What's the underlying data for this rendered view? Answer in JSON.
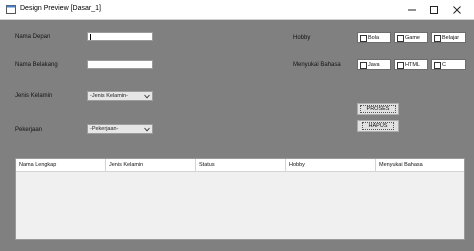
{
  "window": {
    "title": "Design Preview [Dasar_1]",
    "controls": [
      "minimize-icon",
      "maximize-icon",
      "close-icon"
    ]
  },
  "form": {
    "nama_depan_label": "Nama Depan",
    "nama_depan_value": "",
    "nama_belakang_label": "Nama Belakang",
    "nama_belakang_value": "",
    "jenis_kelamin_label": "Jenis Kelamin",
    "jenis_kelamin_selected": "-Jenis Kelamin-",
    "pekerjaan_label": "Pekerjaan",
    "pekerjaan_selected": "-Pekerjaan-",
    "hobby_label": "Hobby",
    "hobby_options": [
      "Bola",
      "Game",
      "Belajar"
    ],
    "bahasa_label": "Menyukai Bahasa",
    "bahasa_options": [
      "Java",
      "HTML",
      "C"
    ]
  },
  "buttons": {
    "proses": "PROSES",
    "hapus": "HAPUS"
  },
  "table": {
    "columns": [
      "Nama Lengkap",
      "Jenis Kelamin",
      "Status",
      "Hobby",
      "Menyukai Bahasa"
    ],
    "rows": []
  }
}
